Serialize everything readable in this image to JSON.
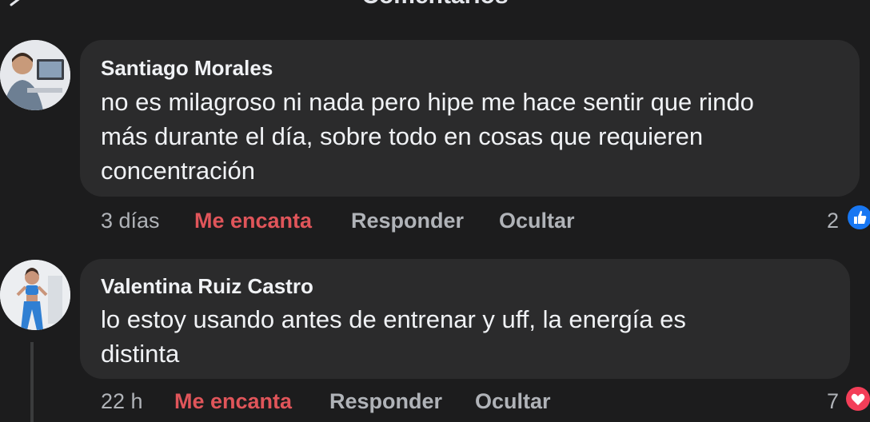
{
  "header": {
    "title": "Comentarios"
  },
  "comments": [
    {
      "author": "Santiago Morales",
      "text": "no es milagroso ni nada pero hipe me hace sentir que rindo\nmás durante el día, sobre todo en cosas que requieren\nconcentración",
      "time": "3 días",
      "love_label": "Me encanta",
      "reply_label": "Responder",
      "hide_label": "Ocultar",
      "reaction_count": "2",
      "reaction_icon": "like-icon"
    },
    {
      "author": "Valentina Ruiz Castro",
      "text": "lo estoy usando antes de entrenar y uff, la energía es\ndistinta",
      "time": "22 h",
      "love_label": "Me encanta",
      "reply_label": "Responder",
      "hide_label": "Ocultar",
      "reaction_count": "7",
      "reaction_icon": "heart-icon"
    }
  ],
  "colors": {
    "love": "#e0555a",
    "like": "#1877f2",
    "heart": "#f33e58"
  }
}
